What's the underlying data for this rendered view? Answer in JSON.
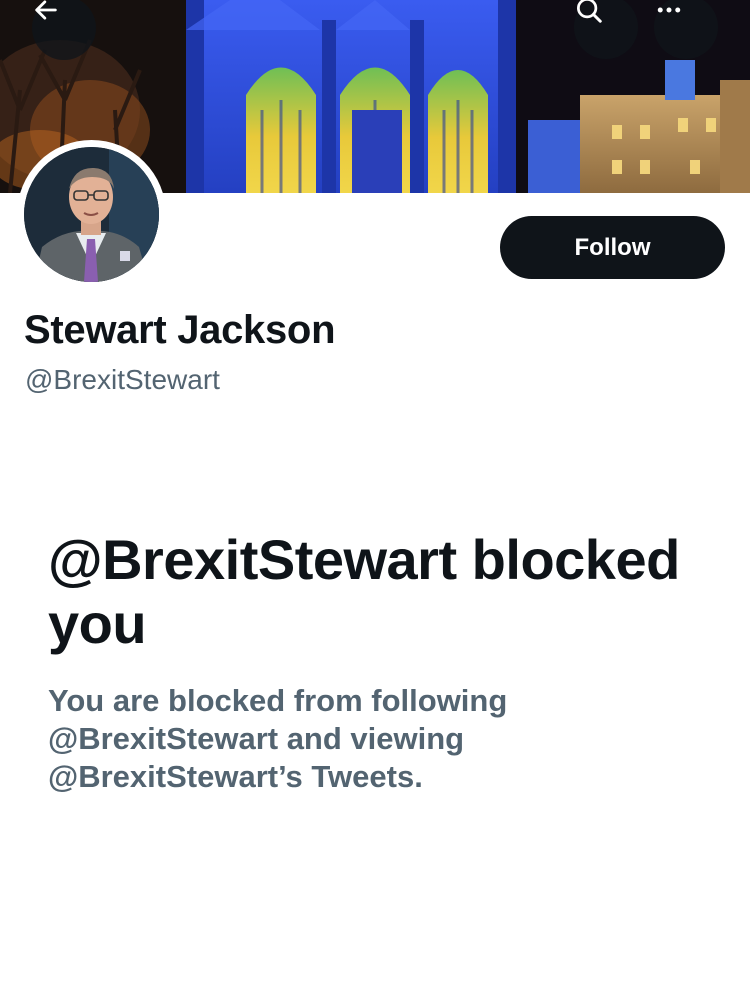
{
  "header": {
    "back_icon": "arrow-left-icon",
    "search_icon": "search-icon",
    "more_icon": "more-horizontal-icon",
    "banner_colors": {
      "sky": "#120e14",
      "lit_blue": "#2f4fd8",
      "lit_yellow": "#e8c93a",
      "lit_green": "#6fbf55",
      "warm_light": "#d8833a"
    }
  },
  "profile": {
    "display_name": "Stewart Jackson",
    "handle": "@BrexitStewart",
    "follow_label": "Follow"
  },
  "blocked": {
    "title": "@BrexitStewart blocked you",
    "description": "You are blocked from following @BrexitStewart and viewing @BrexitStewart’s Tweets."
  },
  "colors": {
    "primary_text": "#0f1419",
    "secondary_text": "#536471",
    "button_bg": "#0f1419",
    "button_text": "#ffffff"
  }
}
